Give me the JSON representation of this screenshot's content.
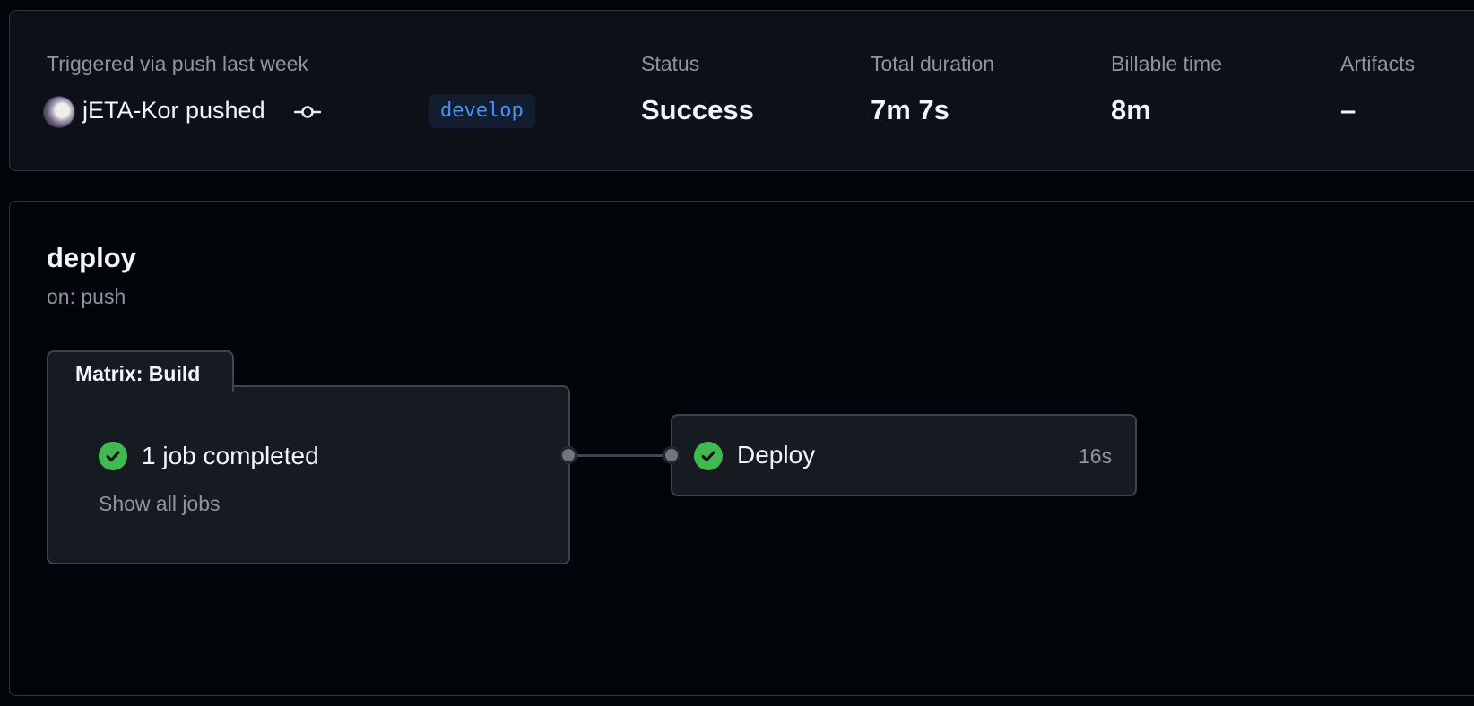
{
  "summary": {
    "trigger_label": "Triggered via push last week",
    "actor_text": "jETA-Kor pushed",
    "branch": "develop",
    "status_label": "Status",
    "status_value": "Success",
    "duration_label": "Total duration",
    "duration_value": "7m 7s",
    "billable_label": "Billable time",
    "billable_value": "8m",
    "artifacts_label": "Artifacts",
    "artifacts_value": "–"
  },
  "workflow": {
    "name": "deploy",
    "event": "on: push",
    "matrix": {
      "title": "Matrix: Build",
      "status_text": "1 job completed",
      "show_all": "Show all jobs"
    },
    "deploy_job": {
      "name": "Deploy",
      "duration": "16s"
    }
  },
  "colors": {
    "success": "#3fb950",
    "branch_text": "#4493f8",
    "background": "#010409"
  },
  "icons": [
    "avatar",
    "git-commit-icon",
    "check-circle-icon"
  ]
}
